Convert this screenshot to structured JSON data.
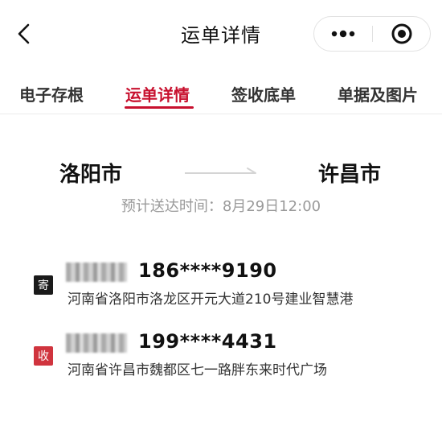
{
  "header": {
    "title": "运单详情",
    "back_icon": "chevron-left-icon",
    "more_icon": "more-dots-icon",
    "close_icon": "target-circle-icon"
  },
  "tabs": [
    {
      "label": "电子存根",
      "active": false
    },
    {
      "label": "运单详情",
      "active": true
    },
    {
      "label": "签收底单",
      "active": false
    },
    {
      "label": "单据及图片",
      "active": false
    }
  ],
  "route": {
    "origin": "洛阳市",
    "destination": "许昌市",
    "eta": "预计送达时间：8月29日12:00"
  },
  "sender": {
    "badge": "寄",
    "phone": "186****9190",
    "address": "河南省洛阳市洛龙区开元大道210号建业智慧港"
  },
  "receiver": {
    "badge": "收",
    "phone": "199****4431",
    "address": "河南省许昌市魏都区七一路胖东来时代广场"
  },
  "colors": {
    "accent": "#c8102e",
    "receive_badge": "#d0343e",
    "send_badge": "#1a1a1a",
    "muted_text": "#9a9a9a"
  }
}
